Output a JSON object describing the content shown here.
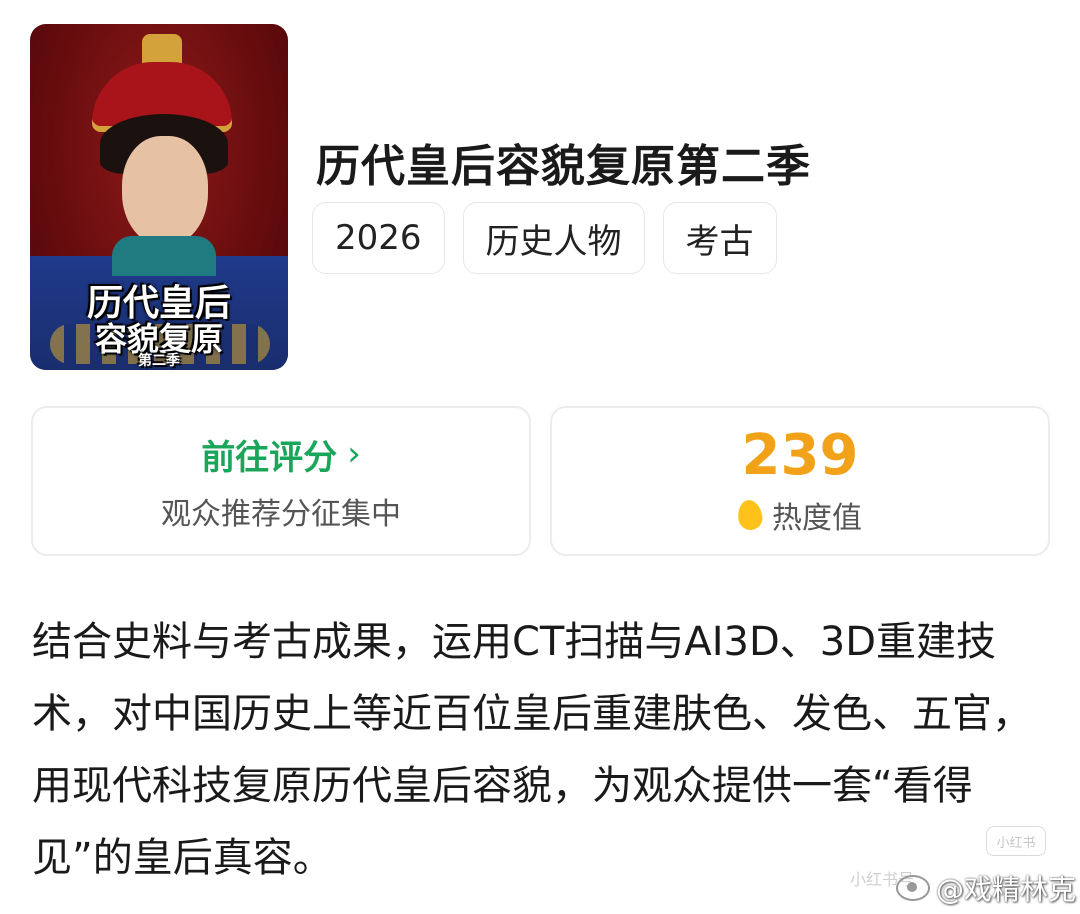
{
  "poster": {
    "title_line1": "历代皇后",
    "title_line2": "容貌复原",
    "title_line3": "第二季"
  },
  "show": {
    "title": "历代皇后容貌复原第二季",
    "tags": [
      "2026",
      "历史人物",
      "考古"
    ]
  },
  "rating_card": {
    "action_label": "前往评分",
    "chevron": "›",
    "subtext": "观众推荐分征集中"
  },
  "heat_card": {
    "value": "239",
    "label": "热度值",
    "icon": "flame-icon"
  },
  "description": "结合史料与考古成果，运用CT扫描与AI3D、3D重建技术，对中国历史上等近百位皇后重建肤色、发色、五官，用现代科技复原历代皇后容貌，为观众提供一套“看得见”的皇后真容。",
  "watermark": {
    "badge": "小红书",
    "faint": "小红书号",
    "weibo_handle": "@戏精林克"
  },
  "colors": {
    "accent_green": "#1aa65a",
    "heat_orange": "#f2a218",
    "flame_yellow": "#ffc21a"
  }
}
